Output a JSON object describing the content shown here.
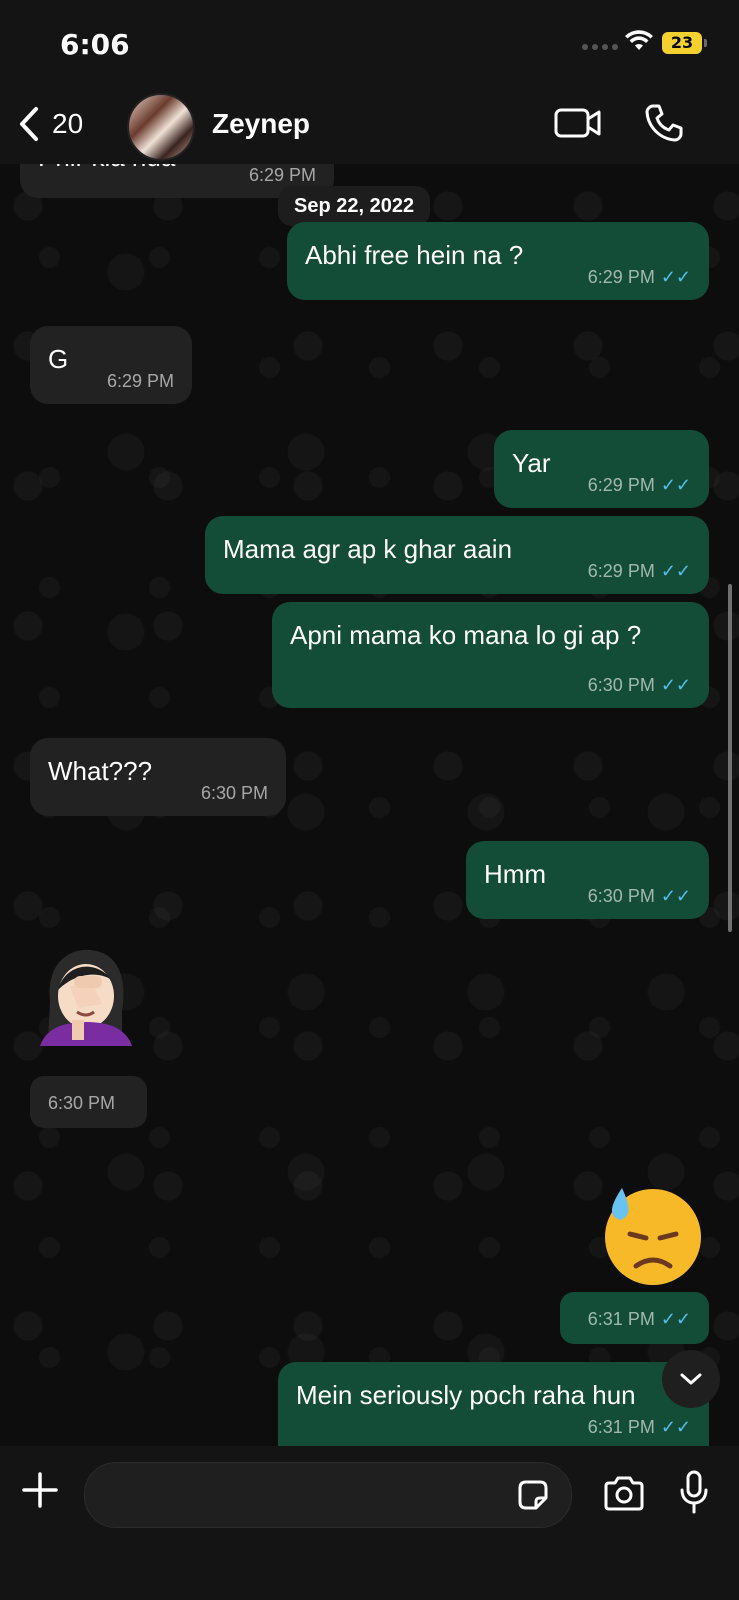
{
  "status_bar": {
    "time": "6:06",
    "battery": "23"
  },
  "header": {
    "back_count": "20",
    "contact_name": "Zeynep"
  },
  "chat": {
    "date_separator": "Sep 22, 2022",
    "messages": [
      {
        "direction": "in",
        "text": "Phir kia hua",
        "time": "6:29 PM"
      },
      {
        "direction": "out",
        "text": "Abhi free hein na ?",
        "time": "6:29 PM"
      },
      {
        "direction": "in",
        "text": "G",
        "time": "6:29 PM"
      },
      {
        "direction": "out",
        "text": "Yar",
        "time": "6:29 PM"
      },
      {
        "direction": "out",
        "text": "Mama agr ap k ghar aain",
        "time": "6:29 PM"
      },
      {
        "direction": "out",
        "text": "Apni mama ko mana lo gi ap ?",
        "time": "6:30 PM"
      },
      {
        "direction": "in",
        "text": "What???",
        "time": "6:30 PM"
      },
      {
        "direction": "out",
        "text": "Hmm",
        "time": "6:30 PM"
      },
      {
        "direction": "in",
        "emoji": "woman-facepalming",
        "time": "6:30 PM"
      },
      {
        "direction": "out",
        "emoji": "downcast-face-with-sweat",
        "time": "6:31 PM"
      },
      {
        "direction": "out",
        "text": "Mein seriously poch raha hun",
        "time": "6:31 PM"
      }
    ]
  },
  "colors": {
    "incoming": "#222223",
    "outgoing": "#134d37",
    "read_ticks": "#53bdeb",
    "battery": "#f5d130"
  }
}
